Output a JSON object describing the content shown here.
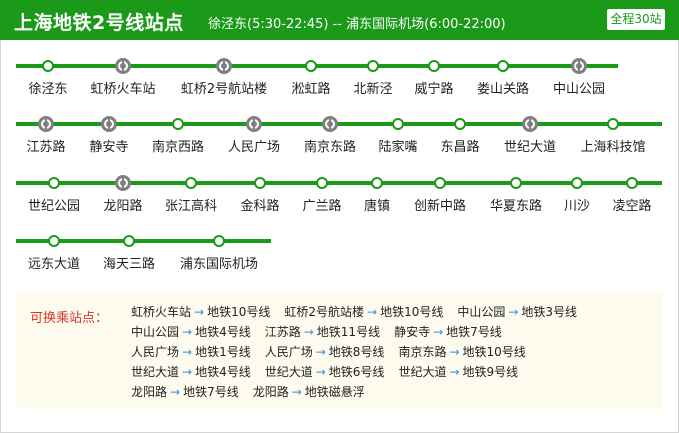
{
  "header": {
    "title": "上海地铁2号线站点",
    "subtitle": "徐泾东(5:30-22:45) -- 浦东国际机场(6:00-22:00)",
    "badge": "全程30站"
  },
  "colors": {
    "line": "#1a9a18",
    "transfer_station": "#7f7f7f",
    "transfer_title": "#e0352b",
    "arrow": "#3a8fd6"
  },
  "rows": [
    {
      "stations": [
        {
          "name": "徐泾东",
          "transfer": false
        },
        {
          "name": "虹桥火车站",
          "transfer": true
        },
        {
          "name": "虹桥2号航站楼",
          "transfer": true
        },
        {
          "name": "淞虹路",
          "transfer": false
        },
        {
          "name": "北新泾",
          "transfer": false
        },
        {
          "name": "威宁路",
          "transfer": false
        },
        {
          "name": "娄山关路",
          "transfer": false
        },
        {
          "name": "中山公园",
          "transfer": true
        }
      ]
    },
    {
      "stations": [
        {
          "name": "江苏路",
          "transfer": true
        },
        {
          "name": "静安寺",
          "transfer": true
        },
        {
          "name": "南京西路",
          "transfer": false
        },
        {
          "name": "人民广场",
          "transfer": true
        },
        {
          "name": "南京东路",
          "transfer": true
        },
        {
          "name": "陆家嘴",
          "transfer": false
        },
        {
          "name": "东昌路",
          "transfer": false
        },
        {
          "name": "世纪大道",
          "transfer": true
        },
        {
          "name": "上海科技馆",
          "transfer": false
        }
      ]
    },
    {
      "stations": [
        {
          "name": "世纪公园",
          "transfer": false
        },
        {
          "name": "龙阳路",
          "transfer": true
        },
        {
          "name": "张江高科",
          "transfer": false
        },
        {
          "name": "金科路",
          "transfer": false
        },
        {
          "name": "广兰路",
          "transfer": false
        },
        {
          "name": "唐镇",
          "transfer": false
        },
        {
          "name": "创新中路",
          "transfer": false
        },
        {
          "name": "华夏东路",
          "transfer": false
        },
        {
          "name": "川沙",
          "transfer": false
        },
        {
          "name": "凌空路",
          "transfer": false
        }
      ]
    },
    {
      "stations": [
        {
          "name": "远东大道",
          "transfer": false
        },
        {
          "name": "海天三路",
          "transfer": false
        },
        {
          "name": "浦东国际机场",
          "transfer": false
        }
      ]
    }
  ],
  "transfers": {
    "title": "可换乘站点：",
    "rows": [
      [
        {
          "station": "虹桥火车站",
          "line": "地铁10号线"
        },
        {
          "station": "虹桥2号航站楼",
          "line": "地铁10号线"
        },
        {
          "station": "中山公园",
          "line": "地铁3号线"
        }
      ],
      [
        {
          "station": "中山公园",
          "line": "地铁4号线"
        },
        {
          "station": "江苏路",
          "line": "地铁11号线"
        },
        {
          "station": "静安寺",
          "line": "地铁7号线"
        }
      ],
      [
        {
          "station": "人民广场",
          "line": "地铁1号线"
        },
        {
          "station": "人民广场",
          "line": "地铁8号线"
        },
        {
          "station": "南京东路",
          "line": "地铁10号线"
        }
      ],
      [
        {
          "station": "世纪大道",
          "line": "地铁4号线"
        },
        {
          "station": "世纪大道",
          "line": "地铁6号线"
        },
        {
          "station": "世纪大道",
          "line": "地铁9号线"
        }
      ],
      [
        {
          "station": "龙阳路",
          "line": "地铁7号线"
        },
        {
          "station": "龙阳路",
          "line": "地铁磁悬浮"
        }
      ]
    ]
  }
}
